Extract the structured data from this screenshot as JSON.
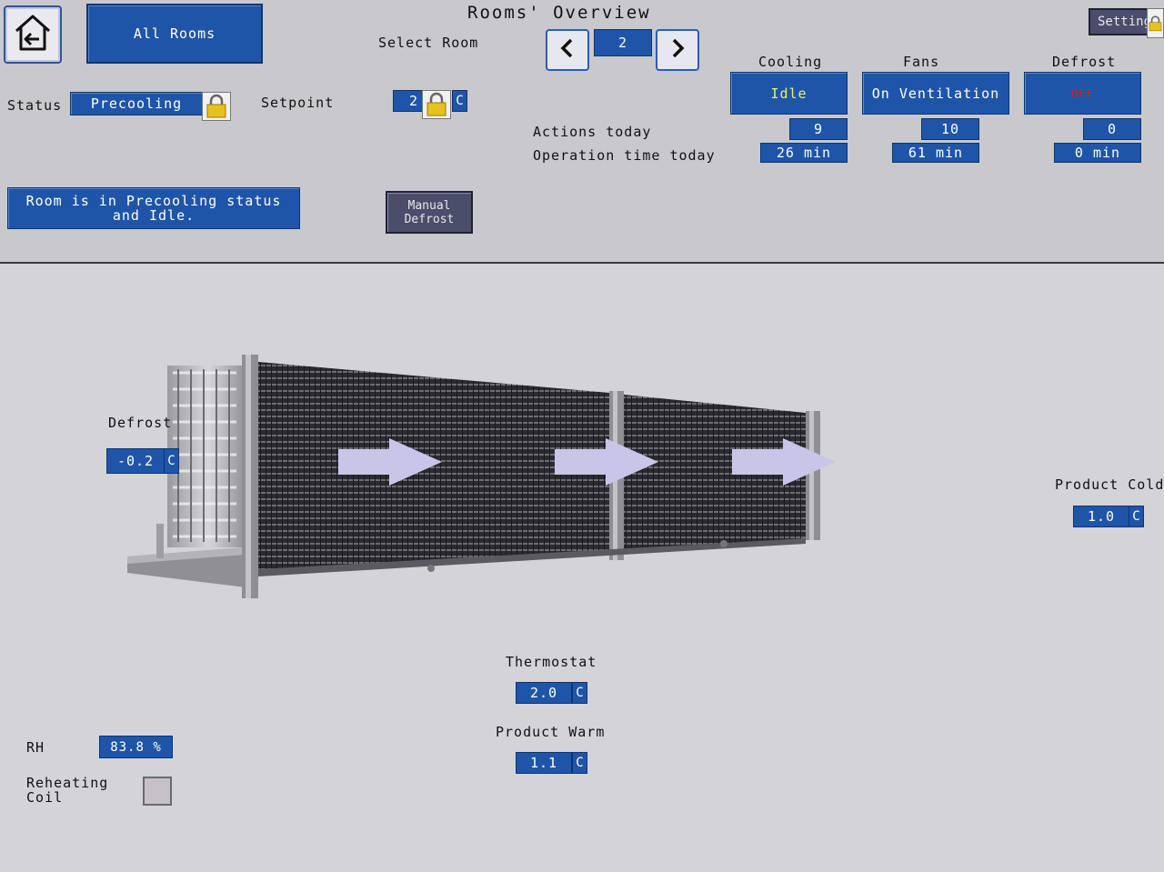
{
  "title": "Rooms' Overview",
  "nav": {
    "all_rooms": "All Rooms",
    "select_room_label": "Select Room",
    "room_number": "2",
    "settings": "Settings"
  },
  "status": {
    "label": "Status",
    "value": "Precooling",
    "setpoint_label": "Setpoint",
    "setpoint_value": "2",
    "setpoint_unit": "C",
    "message": "Room is in Precooling status and Idle.",
    "manual_defrost_line1": "Manual",
    "manual_defrost_line2": "Defrost"
  },
  "stats": {
    "actions_label": "Actions today",
    "operation_label": "Operation time today",
    "cooling": {
      "label": "Cooling",
      "state": "Idle",
      "actions": "9",
      "time": "26 min"
    },
    "fans": {
      "label": "Fans",
      "state": "On Ventilation",
      "actions": "10",
      "time": "61 min"
    },
    "defrost": {
      "label": "Defrost",
      "state": "OFF",
      "actions": "0",
      "time": "0 min"
    }
  },
  "sensors": {
    "defrost": {
      "label": "Defrost",
      "value": "-0.2",
      "unit": "C"
    },
    "product_cold": {
      "label": "Product Cold",
      "value": "1.0",
      "unit": "C"
    },
    "thermostat": {
      "label": "Thermostat",
      "value": "2.0",
      "unit": "C"
    },
    "product_warm": {
      "label": "Product Warm",
      "value": "1.1",
      "unit": "C"
    },
    "rh": {
      "label": "RH",
      "value": "83.8 %"
    },
    "reheating_line1": "Reheating",
    "reheating_line2": "Coil"
  },
  "colors": {
    "panel_blue": "#1f55a8",
    "idle_text": "#e8f070",
    "defrost_off_text": "#d22020",
    "airflow_arrow": "#c9c5e8"
  }
}
